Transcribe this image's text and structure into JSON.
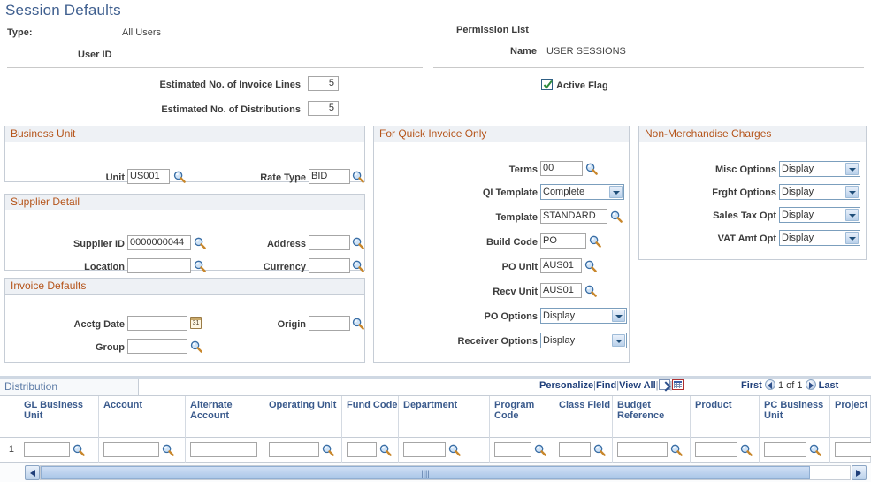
{
  "page": {
    "title": "Session Defaults"
  },
  "header": {
    "type_label": "Type:",
    "type_value": "All Users",
    "userid_label": "User ID",
    "permission_list_label": "Permission List",
    "name_label": "Name",
    "name_value": "USER SESSIONS",
    "est_invoice_lines_label": "Estimated No. of Invoice Lines",
    "est_invoice_lines_value": "5",
    "est_distributions_label": "Estimated No. of Distributions",
    "est_distributions_value": "5",
    "active_flag_label": "Active Flag",
    "active_flag_checked": true
  },
  "business_unit": {
    "title": "Business Unit",
    "unit_label": "Unit",
    "unit_value": "US001",
    "rate_type_label": "Rate Type",
    "rate_type_value": "BID"
  },
  "supplier_detail": {
    "title": "Supplier Detail",
    "supplier_id_label": "Supplier ID",
    "supplier_id_value": "0000000044",
    "address_label": "Address",
    "address_value": "",
    "location_label": "Location",
    "location_value": "",
    "currency_label": "Currency",
    "currency_value": ""
  },
  "invoice_defaults": {
    "title": "Invoice Defaults",
    "acctg_date_label": "Acctg Date",
    "acctg_date_value": "",
    "origin_label": "Origin",
    "origin_value": "",
    "group_label": "Group",
    "group_value": ""
  },
  "quick_invoice": {
    "title": "For Quick Invoice Only",
    "terms_label": "Terms",
    "terms_value": "00",
    "qi_template_label": "QI Template",
    "qi_template_value": "Complete",
    "template_label": "Template",
    "template_value": "STANDARD",
    "build_code_label": "Build Code",
    "build_code_value": "PO",
    "po_unit_label": "PO Unit",
    "po_unit_value": "AUS01",
    "recv_unit_label": "Recv Unit",
    "recv_unit_value": "AUS01",
    "po_options_label": "PO Options",
    "po_options_value": "Display",
    "receiver_options_label": "Receiver Options",
    "receiver_options_value": "Display"
  },
  "non_merchandise": {
    "title": "Non-Merchandise Charges",
    "misc_options_label": "Misc Options",
    "misc_options_value": "Display",
    "frght_options_label": "Frght Options",
    "frght_options_value": "Display",
    "sales_tax_opt_label": "Sales Tax Opt",
    "sales_tax_opt_value": "Display",
    "vat_amt_opt_label": "VAT Amt Opt",
    "vat_amt_opt_value": "Display"
  },
  "distribution": {
    "tab_label": "Distribution",
    "toolbar": {
      "personalize": "Personalize",
      "find": "Find",
      "view_all": "View All",
      "sep": "|",
      "new_window_icon": "new-window-icon",
      "grid_icon": "download-grid-icon",
      "first": "First",
      "page_indicator": "1 of 1",
      "last": "Last"
    },
    "columns": [
      "GL Business Unit",
      "Account",
      "Alternate Account",
      "Operating Unit",
      "Fund Code",
      "Department",
      "Program Code",
      "Class Field",
      "Budget Reference",
      "Product",
      "PC Business Unit",
      "Project"
    ],
    "rows": [
      {
        "num": "1",
        "cells": [
          "",
          "",
          "",
          "",
          "",
          "",
          "",
          "",
          "",
          "",
          "",
          ""
        ]
      }
    ]
  },
  "colors": {
    "title": "#3f5f8f",
    "group_header_text": "#b5541a",
    "group_header_bg": "#eef1f5",
    "grid_header_text": "#3a5a8c",
    "link": "#1f3f7a",
    "checkbox_check": "#2e8b3e"
  }
}
